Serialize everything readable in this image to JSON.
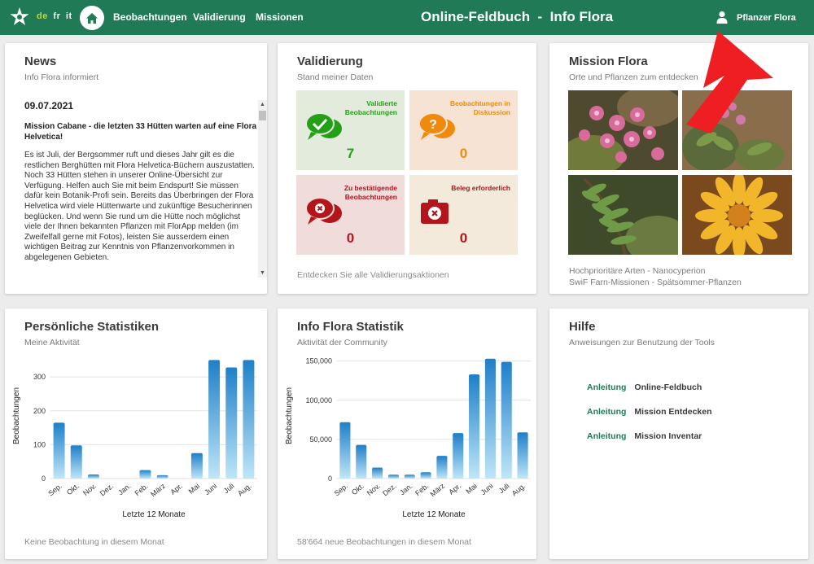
{
  "header": {
    "languages": [
      "de",
      "fr",
      "it"
    ],
    "active_language": "de",
    "nav": [
      "Beobachtungen",
      "Validierung",
      "Missionen"
    ],
    "title": "Online-Feldbuch  -  Info Flora",
    "user_name": "Pflanzer Flora",
    "colors": {
      "bar": "#1f7a55",
      "active_lang": "#b9d84a"
    }
  },
  "news": {
    "title": "News",
    "subtitle": "Info Flora informiert",
    "date": "09.07.2021",
    "headline": "Mission Cabane - die letzten 33 Hütten warten auf eine Flora Helvetica!",
    "body": "Es ist Juli, der Bergsommer ruft und dieses Jahr gilt es die restlichen Berghütten mit Flora Helvetica-Büchern auszustatten. Noch 33 Hütten stehen in unserer Online-Übersicht zur Verfügung. Helfen auch Sie mit beim Endspurt! Sie müssen dafür kein Botanik-Profi sein. Bereits das Überbringen der Flora Helvetica wird viele Hüttenwarte und zukünftige Besucherinnen beglücken. Und wenn Sie rund um die Hütte noch möglichst viele der Ihnen bekannten Pflanzen mit FlorApp melden (im Zweifelfall gerne mit Fotos), leisten Sie ausserdem einen wichtigen Beitrag zur Kenntnis von Pflanzenvorkommen in abgelegenen Gebieten."
  },
  "validation": {
    "title": "Validierung",
    "subtitle": "Stand meiner Daten",
    "tiles": [
      {
        "label": "Validierte Beobachtungen",
        "count": "7",
        "color": "#23a016",
        "bg": "#e3ebdc",
        "icon": "chat-check-icon"
      },
      {
        "label": "Beobachtungen in Diskussion",
        "count": "0",
        "color": "#f08a0c",
        "bg": "#f7e3d4",
        "icon": "chat-question-icon"
      },
      {
        "label": "Zu bestätigende Beobachtungen",
        "count": "0",
        "color": "#b3151b",
        "bg": "#efdcdb",
        "icon": "chat-cross-icon"
      },
      {
        "label": "Beleg erforderlich",
        "count": "0",
        "color": "#b3151b",
        "bg": "#f3eadc",
        "icon": "camera-cross-icon"
      }
    ],
    "footer": "Entdecken Sie alle Validierungsaktionen"
  },
  "mission": {
    "title": "Mission Flora",
    "subtitle": "Orte und Pflanzen zum entdecken",
    "links": [
      "Hochprioritäre Arten - Nanocyperion",
      "SwiF Farn-Missionen - Spätsommer-Pflanzen"
    ]
  },
  "personal_stats": {
    "title": "Persönliche Statistiken",
    "subtitle": "Meine Aktivität",
    "footer": "Keine Beobachtung in diesem Monat"
  },
  "community_stats": {
    "title": "Info Flora Statistik",
    "subtitle": "Aktivität der Community",
    "footer": "58'664 neue Beobachtungen in diesem Monat"
  },
  "help": {
    "title": "Hilfe",
    "subtitle": "Anweisungen zur Benutzung der Tools",
    "link_label": "Anleitung",
    "items": [
      "Online-Feldbuch",
      "Mission Entdecken",
      "Mission Inventar"
    ]
  },
  "chart_data": [
    {
      "type": "bar",
      "categories": [
        "Sep.",
        "Okt.",
        "Nov.",
        "Dez.",
        "Jan.",
        "Feb.",
        "März",
        "Apr.",
        "Mai",
        "Juni",
        "Juli",
        "Aug."
      ],
      "values": [
        165,
        98,
        12,
        0,
        0,
        25,
        10,
        0,
        75,
        350,
        328,
        350
      ],
      "yticks": [
        0,
        100,
        200,
        300
      ],
      "ylabel": "Beobachtungen",
      "xlabel": "Letzte 12 Monate",
      "ylim": [
        0,
        370
      ]
    },
    {
      "type": "bar",
      "categories": [
        "Sep.",
        "Okt.",
        "Nov.",
        "Dez.",
        "Jan.",
        "Feb.",
        "März",
        "Apr.",
        "Mai",
        "Juni",
        "Juli",
        "Aug."
      ],
      "values": [
        72000,
        43000,
        14000,
        5000,
        5000,
        8000,
        29000,
        58000,
        133000,
        153000,
        149000,
        59000
      ],
      "yticks": [
        "0",
        "50,000",
        "100,000",
        "150,000"
      ],
      "ylabel": "Beobachtungen",
      "xlabel": "Letzte 12 Monate",
      "ylim": [
        0,
        160000
      ]
    }
  ]
}
